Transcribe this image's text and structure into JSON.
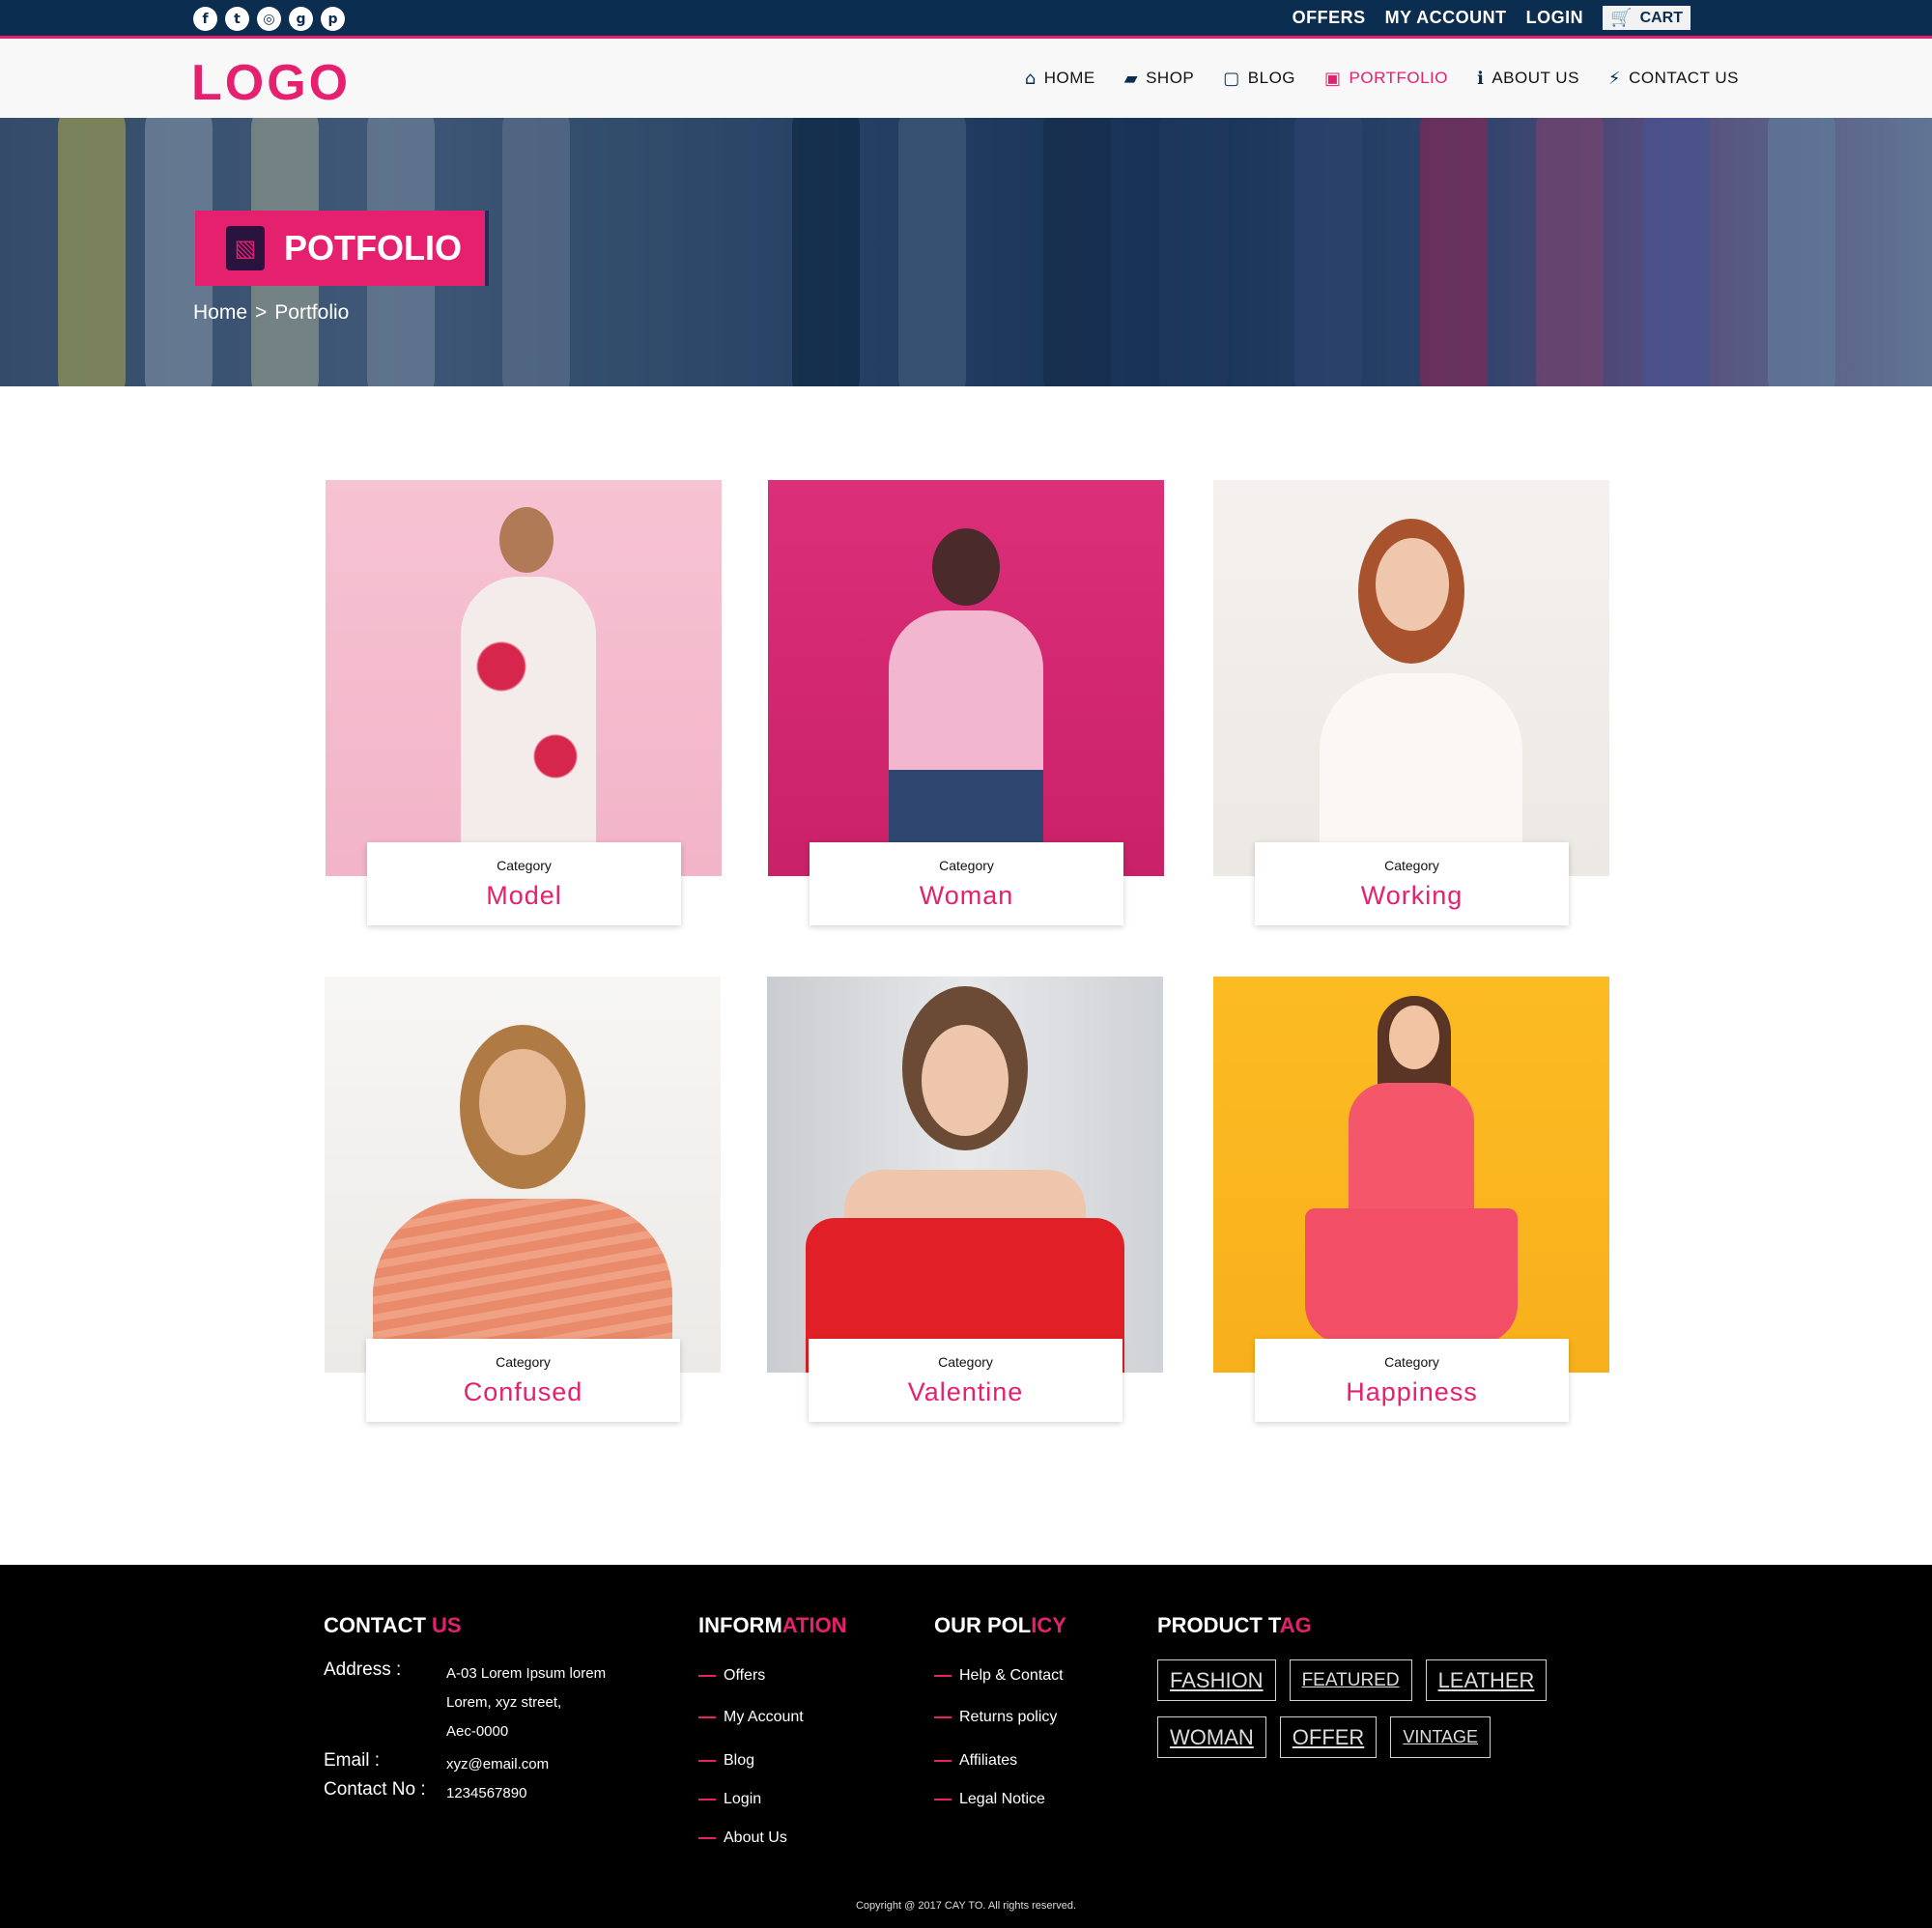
{
  "topbar": {
    "social_icons": [
      "facebook-icon",
      "twitter-icon",
      "instagram-icon",
      "google-plus-icon",
      "pinterest-icon"
    ],
    "links": [
      "OFFERS",
      "MY ACCOUNT",
      "LOGIN"
    ],
    "cart_label": "CART"
  },
  "header": {
    "logo": "LOGO",
    "nav": [
      {
        "label": "HOME",
        "icon": "home-icon"
      },
      {
        "label": "SHOP",
        "icon": "shopping-bag-icon"
      },
      {
        "label": "BLOG",
        "icon": "note-icon"
      },
      {
        "label": "PORTFOLIO",
        "icon": "image-file-icon",
        "active": true
      },
      {
        "label": "ABOUT US",
        "icon": "info-icon"
      },
      {
        "label": "CONTACT US",
        "icon": "plug-icon"
      }
    ]
  },
  "hero": {
    "badge_title": "POTFOLIO",
    "breadcrumb": [
      "Home",
      ">",
      "Portfolio"
    ]
  },
  "portfolio": [
    {
      "category_label": "Category",
      "title": "Model"
    },
    {
      "category_label": "Category",
      "title": "Woman"
    },
    {
      "category_label": "Category",
      "title": "Working"
    },
    {
      "category_label": "Category",
      "title": "Confused"
    },
    {
      "category_label": "Category",
      "title": "Valentine"
    },
    {
      "category_label": "Category",
      "title": "Happiness"
    }
  ],
  "footer": {
    "contact": {
      "heading_main": "CONTACT ",
      "heading_accent": "US",
      "address_label": "Address :",
      "address_lines": [
        "A-03 Lorem Ipsum lorem",
        "Lorem, xyz street,",
        "Aec-0000"
      ],
      "email_label": "Email :",
      "email": "xyz@email.com",
      "phone_label": "Contact No :",
      "phone": "1234567890"
    },
    "information": {
      "heading_main": "INFORM",
      "heading_accent": "ATION",
      "items": [
        "Offers",
        "My Account",
        "Blog",
        "Login",
        "About Us"
      ]
    },
    "policy": {
      "heading_main": "OUR POL",
      "heading_accent": "ICY",
      "items": [
        "Help & Contact",
        "Returns policy",
        "Affiliates",
        "Legal Notice"
      ]
    },
    "tags": {
      "heading_main": "PRODUCT T",
      "heading_accent": "AG",
      "items": [
        "FASHION",
        "FEATURED",
        "LEATHER",
        "WOMAN",
        "OFFER",
        "VINTAGE"
      ]
    },
    "copyright": "Copyright @ 2017 CAY TO. All rights reserved."
  },
  "colors": {
    "accent": "#e5206f",
    "navy": "#0b2d50",
    "footer_bg": "#000000"
  }
}
